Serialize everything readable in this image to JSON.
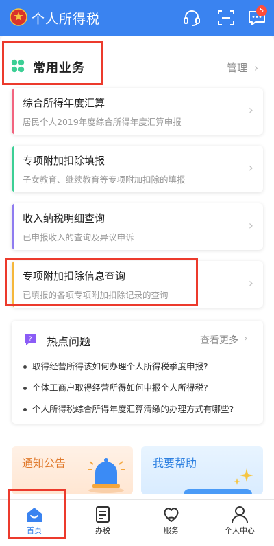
{
  "header": {
    "title": "个人所得税",
    "message_badge": "5"
  },
  "common": {
    "title": "常用业务",
    "manage_label": "管理",
    "items": [
      {
        "title": "综合所得年度汇算",
        "subtitle": "居民个人2019年度综合所得年度汇算申报",
        "stripe_color": "#f2647f"
      },
      {
        "title": "专项附加扣除填报",
        "subtitle": "子女教育、继续教育等专项附加扣除的填报",
        "stripe_color": "#3ccf95"
      },
      {
        "title": "收入纳税明细查询",
        "subtitle": "已申报收入的查询及异议申诉",
        "stripe_color": "#8f7cf0"
      },
      {
        "title": "专项附加扣除信息查询",
        "subtitle": "已填报的各项专项附加扣除记录的查询",
        "stripe_color": "#f5b73b"
      }
    ]
  },
  "hot": {
    "title": "热点问题",
    "more_label": "查看更多",
    "items": [
      "取得经营所得该如何办理个人所得税季度申报?",
      "个体工商户取得经营所得如何申报个人所得税?",
      "个人所得税综合所得年度汇算清缴的办理方式有哪些?"
    ]
  },
  "tiles": {
    "notice_label": "通知公告",
    "help_label": "我要帮助"
  },
  "tabbar": {
    "items": [
      {
        "label": "首页",
        "icon": "home-icon",
        "active": true
      },
      {
        "label": "办税",
        "icon": "tax-form-icon",
        "active": false
      },
      {
        "label": "服务",
        "icon": "service-heart-icon",
        "active": false
      },
      {
        "label": "个人中心",
        "icon": "profile-icon",
        "active": false
      }
    ]
  },
  "colors": {
    "brand_blue": "#3a83f0",
    "annotation_red": "#ec3a2c",
    "active_tab": "#2f7ee8"
  }
}
